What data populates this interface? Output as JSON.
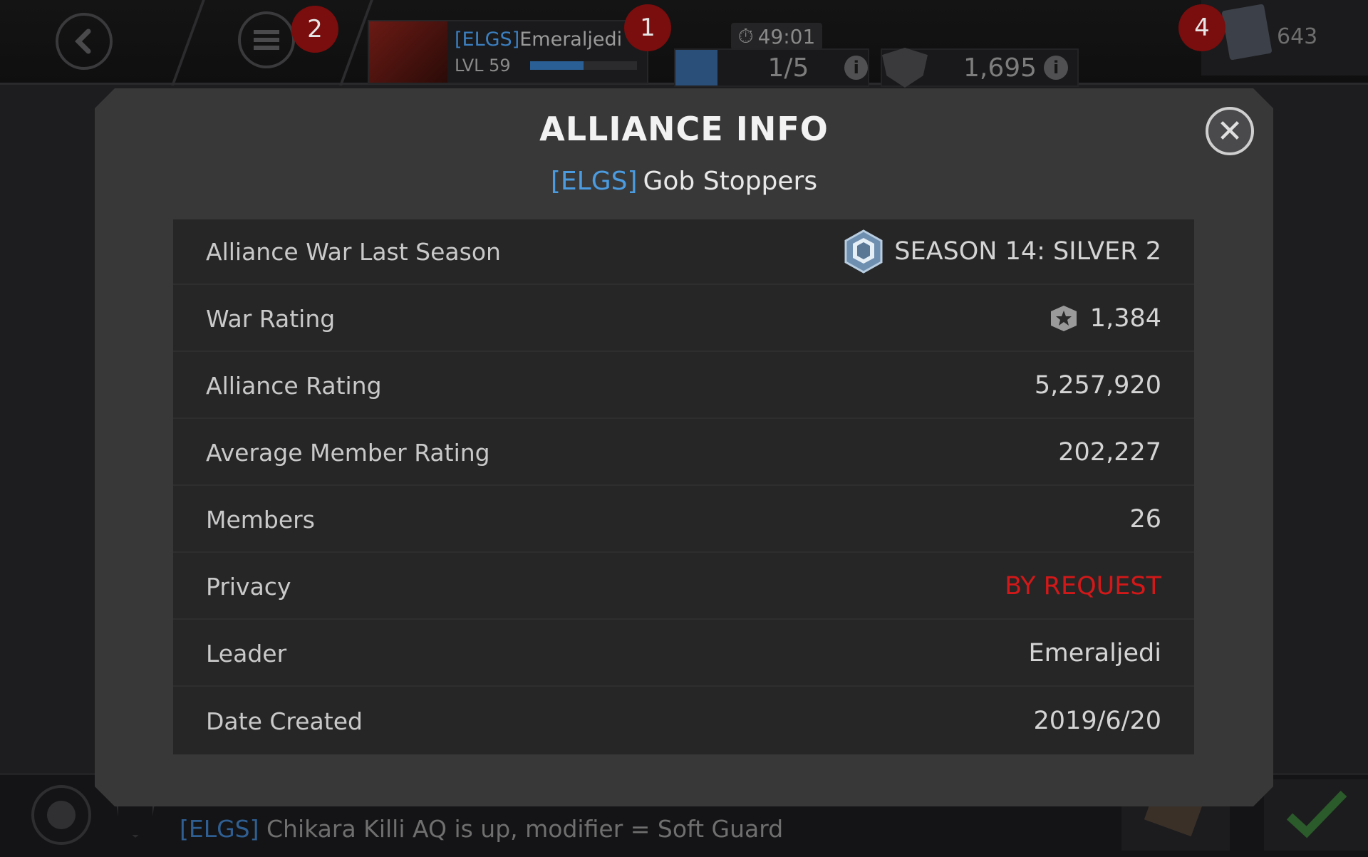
{
  "topbar": {
    "menu_badge": "2",
    "profile_badge": "1",
    "store_badge": "4",
    "player_tag": "[ELGS]",
    "player_name": "Emeraljedi",
    "player_level": "LVL 59",
    "xp_progress": 0.5,
    "timer": "49:01",
    "energy": "1/5",
    "rating": "1,695",
    "currency": "643"
  },
  "modal": {
    "title": "ALLIANCE INFO",
    "alliance_tag": "[ELGS]",
    "alliance_name": "Gob Stoppers",
    "rows": [
      {
        "label": "Alliance War Last Season",
        "value": "SEASON 14: SILVER 2"
      },
      {
        "label": "War Rating",
        "value": "1,384"
      },
      {
        "label": "Alliance Rating",
        "value": "5,257,920"
      },
      {
        "label": "Average Member Rating",
        "value": "202,227"
      },
      {
        "label": "Members",
        "value": "26"
      },
      {
        "label": "Privacy",
        "value": "BY REQUEST"
      },
      {
        "label": "Leader",
        "value": "Emeraljedi"
      },
      {
        "label": "Date Created",
        "value": "2019/6/20"
      }
    ]
  },
  "chat": {
    "line1_tag": "[ELGS]",
    "line1_name": "Chikara Killi",
    "line1_text": "AQ is up, modifier = Soft Guard"
  },
  "colors": {
    "accent_blue": "#4a9be0",
    "privacy_red": "#d21818"
  }
}
